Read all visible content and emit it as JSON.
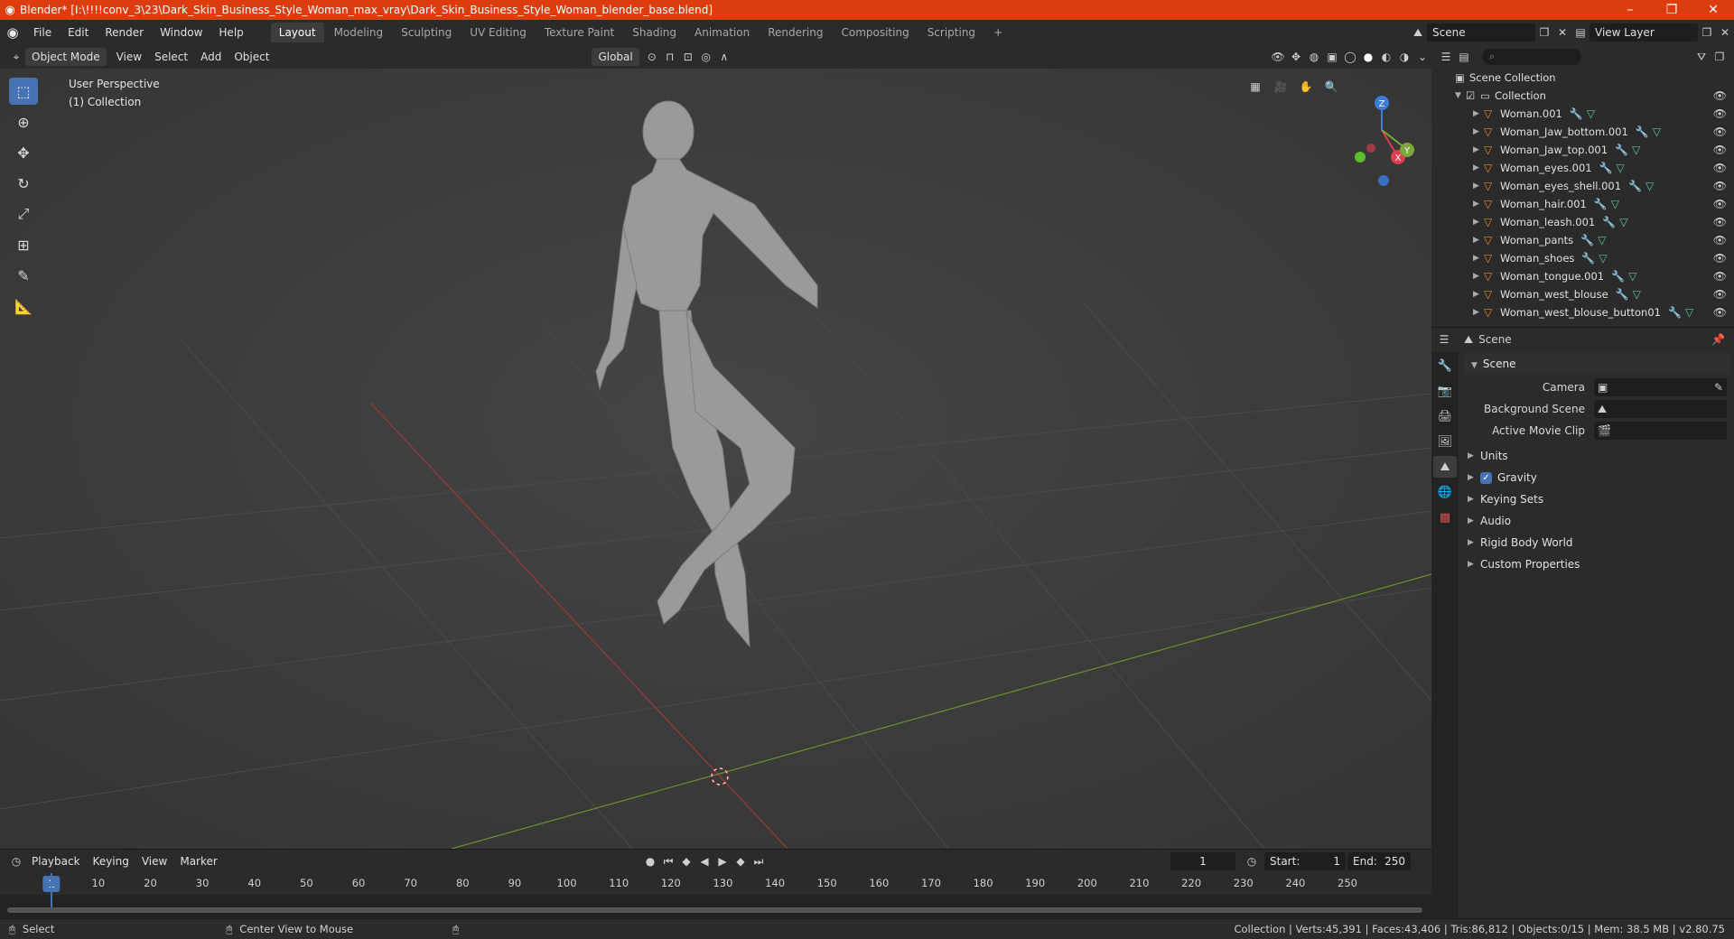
{
  "window": {
    "title": "Blender* [I:\\!!!!conv_3\\23\\Dark_Skin_Business_Style_Woman_max_vray\\Dark_Skin_Business_Style_Woman_blender_base.blend]",
    "minimize": "–",
    "maximize": "❐",
    "close": "✕"
  },
  "menu": [
    "File",
    "Edit",
    "Render",
    "Window",
    "Help"
  ],
  "workspaces": [
    "Layout",
    "Modeling",
    "Sculpting",
    "UV Editing",
    "Texture Paint",
    "Shading",
    "Animation",
    "Rendering",
    "Compositing",
    "Scripting"
  ],
  "add_workspace": "+",
  "scene_field": "Scene",
  "view_layer_field": "View Layer",
  "viewport_header": {
    "mode": "Object Mode",
    "menus": [
      "View",
      "Select",
      "Add",
      "Object"
    ],
    "transform_orientation": "Global"
  },
  "viewport": {
    "perspective": "User Perspective",
    "collection": "(1) Collection",
    "gizmo_axes": [
      "X",
      "Y",
      "Z"
    ]
  },
  "outliner": {
    "root": "Scene Collection",
    "collection": "Collection",
    "objects": [
      "Woman.001",
      "Woman_Jaw_bottom.001",
      "Woman_Jaw_top.001",
      "Woman_eyes.001",
      "Woman_eyes_shell.001",
      "Woman_hair.001",
      "Woman_leash.001",
      "Woman_pants",
      "Woman_shoes",
      "Woman_tongue.001",
      "Woman_west_blouse",
      "Woman_west_blouse_button01"
    ]
  },
  "properties": {
    "header": "Scene",
    "panel": "Scene",
    "fields": [
      {
        "label": "Camera"
      },
      {
        "label": "Background Scene"
      },
      {
        "label": "Active Movie Clip"
      }
    ],
    "subpanels": [
      "Units",
      "Gravity",
      "Keying Sets",
      "Audio",
      "Rigid Body World",
      "Custom Properties"
    ]
  },
  "timeline": {
    "menus": [
      "Playback",
      "Keying",
      "View",
      "Marker"
    ],
    "current_frame": "1",
    "start_label": "Start:",
    "start": "1",
    "end_label": "End:",
    "end": "250",
    "ticks": [
      "10",
      "20",
      "30",
      "40",
      "50",
      "60",
      "70",
      "80",
      "90",
      "100",
      "110",
      "120",
      "130",
      "140",
      "150",
      "160",
      "170",
      "180",
      "190",
      "200",
      "210",
      "220",
      "230",
      "240",
      "250"
    ]
  },
  "statusbar": {
    "left_action": "Select",
    "middle_action": "Center View to Mouse",
    "stats": "Collection | Verts:45,391 | Faces:43,406 | Tris:86,812 | Objects:0/15 | Mem: 38.5 MB | v2.80.75"
  }
}
